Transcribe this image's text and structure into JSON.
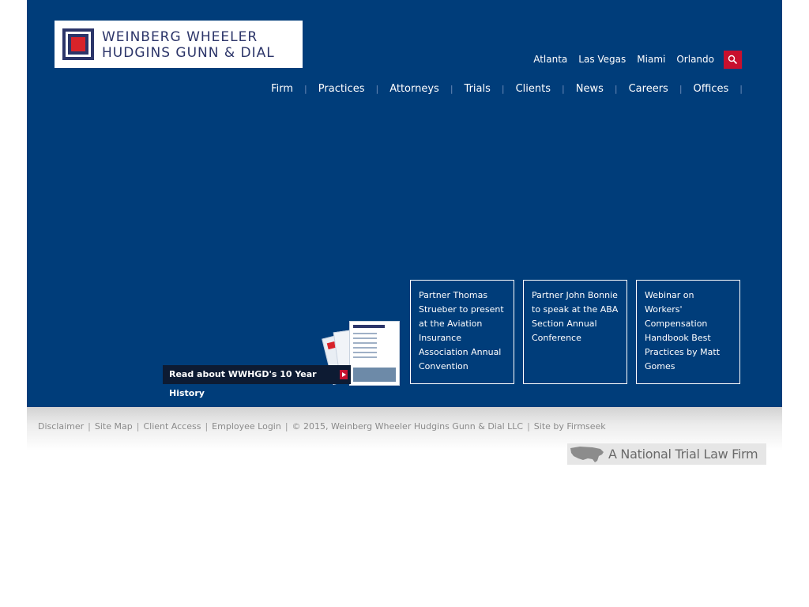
{
  "brand": {
    "line1": "WEINBERG WHEELER",
    "line2": "HUDGINS GUNN & DIAL"
  },
  "offices": [
    "Atlanta",
    "Las Vegas",
    "Miami",
    "Orlando"
  ],
  "nav": [
    "Firm",
    "Practices",
    "Attorneys",
    "Trials",
    "Clients",
    "News",
    "Careers",
    "Offices"
  ],
  "history_link": "Read about WWHGD's 10 Year History",
  "news": [
    "Partner Thomas Strueber to present at the Aviation Insurance Association Annual Convention",
    "Partner John Bonnie to speak at the ABA Section Annual Conference",
    "Webinar on Workers' Compensation Handbook Best Practices by Matt Gomes"
  ],
  "footer": {
    "links": [
      "Disclaimer",
      "Site Map",
      "Client Access",
      "Employee Login",
      "© 2015, Weinberg Wheeler Hudgins Gunn & Dial LLC",
      "Site by Firmseek"
    ],
    "tagline": "A National Trial Law Firm"
  },
  "colors": {
    "primary_blue": "#003d7a",
    "accent_red": "#c8102e",
    "logo_navy": "#2c3569"
  }
}
